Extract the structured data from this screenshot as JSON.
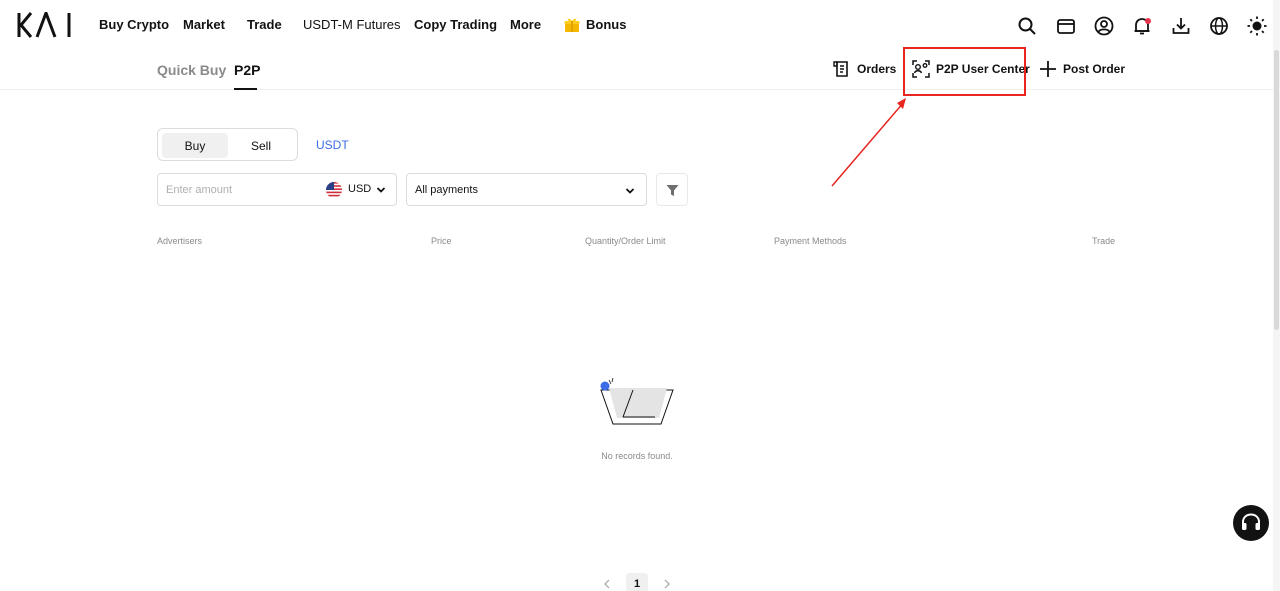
{
  "brand": {
    "logo_text": "KAI"
  },
  "topnav": {
    "items": [
      {
        "label": "Buy Crypto"
      },
      {
        "label": "Market"
      },
      {
        "label": "Trade"
      },
      {
        "label": "USDT-M Futures"
      },
      {
        "label": "Copy Trading"
      },
      {
        "label": "More"
      },
      {
        "label": "Bonus",
        "icon": "gift-icon"
      }
    ],
    "right_icons": [
      "search-icon",
      "wallet-icon",
      "user-account-icon",
      "notification-bell-icon",
      "download-icon",
      "globe-icon",
      "theme-sun-icon"
    ]
  },
  "subnav": {
    "tabs": [
      {
        "label": "Quick Buy",
        "active": false
      },
      {
        "label": "P2P",
        "active": true
      }
    ],
    "actions": {
      "orders": "Orders",
      "user_center": "P2P User Center",
      "post_order": "Post Order"
    }
  },
  "filters": {
    "side_toggle": {
      "buy": "Buy",
      "sell": "Sell",
      "selected": "Buy"
    },
    "asset": "USDT",
    "amount_placeholder": "Enter amount",
    "currency": "USD",
    "payment": "All payments"
  },
  "table": {
    "headers": [
      "Advertisers",
      "Price",
      "Quantity/Order Limit",
      "Payment Methods",
      "Trade"
    ],
    "rows": []
  },
  "empty_state": {
    "text": "No records found."
  },
  "pagination": {
    "current_page": "1"
  },
  "colors": {
    "accent_blue": "#3d6ce7",
    "highlight_red": "#e8251f",
    "text_primary": "#121212",
    "text_muted": "#8a8a8a"
  }
}
